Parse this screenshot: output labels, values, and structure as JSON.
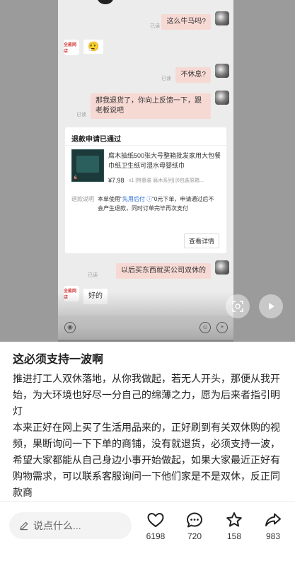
{
  "chat": {
    "read_label": "已读",
    "msg1": "这么牛马吗?",
    "msg2_emoji": "😮‍💨",
    "msg3": "不休息?",
    "msg4": "那我退货了，你向上反馈一下，跟老板说吧",
    "refund_card": {
      "title": "退款申请已通过",
      "product_name": "腐木抽纸500张大号整箱批发家用大包餐巾纸卫生纸可湿水母婴纸巾",
      "price": "¥7.98",
      "spec": "x1 [特惠装 腐木系列] [6包装原箱...",
      "note_label": "退款说明",
      "note_text_pre": "本单使用\"",
      "note_text_highlight": "先用后付 ⓘ",
      "note_text_post": "\"0元下单，申请通过后不会产生退款，同时订单完毕再次支付",
      "detail_button": "查看详情"
    },
    "msg5": "以后买东西就买公司双休的",
    "msg6": "好的",
    "shop_avatar_text": "全能网店"
  },
  "post": {
    "title": "这必须支持一波啊",
    "paragraphs": [
      "推进打工人双休落地，从你我做起，若无人开头，那便从我开始，为大环境也好尽一分自己的绵薄之力，愿为后来者指引明灯",
      "本来正好在网上买了生活用品来的，正好刷到有关双休购的视频，果断询问一下下单的商铺，没有就退货，必须支持一波，希望大家都能从自己身边小事开始做起，如果大家最近正好有购物需求，可以联系客服询问一下他们家是不是双休，反正同款商"
    ]
  },
  "bottom_bar": {
    "comment_placeholder": "说点什么...",
    "like_count": "6198",
    "comment_count": "720",
    "collect_count": "158",
    "share_count": "983"
  }
}
